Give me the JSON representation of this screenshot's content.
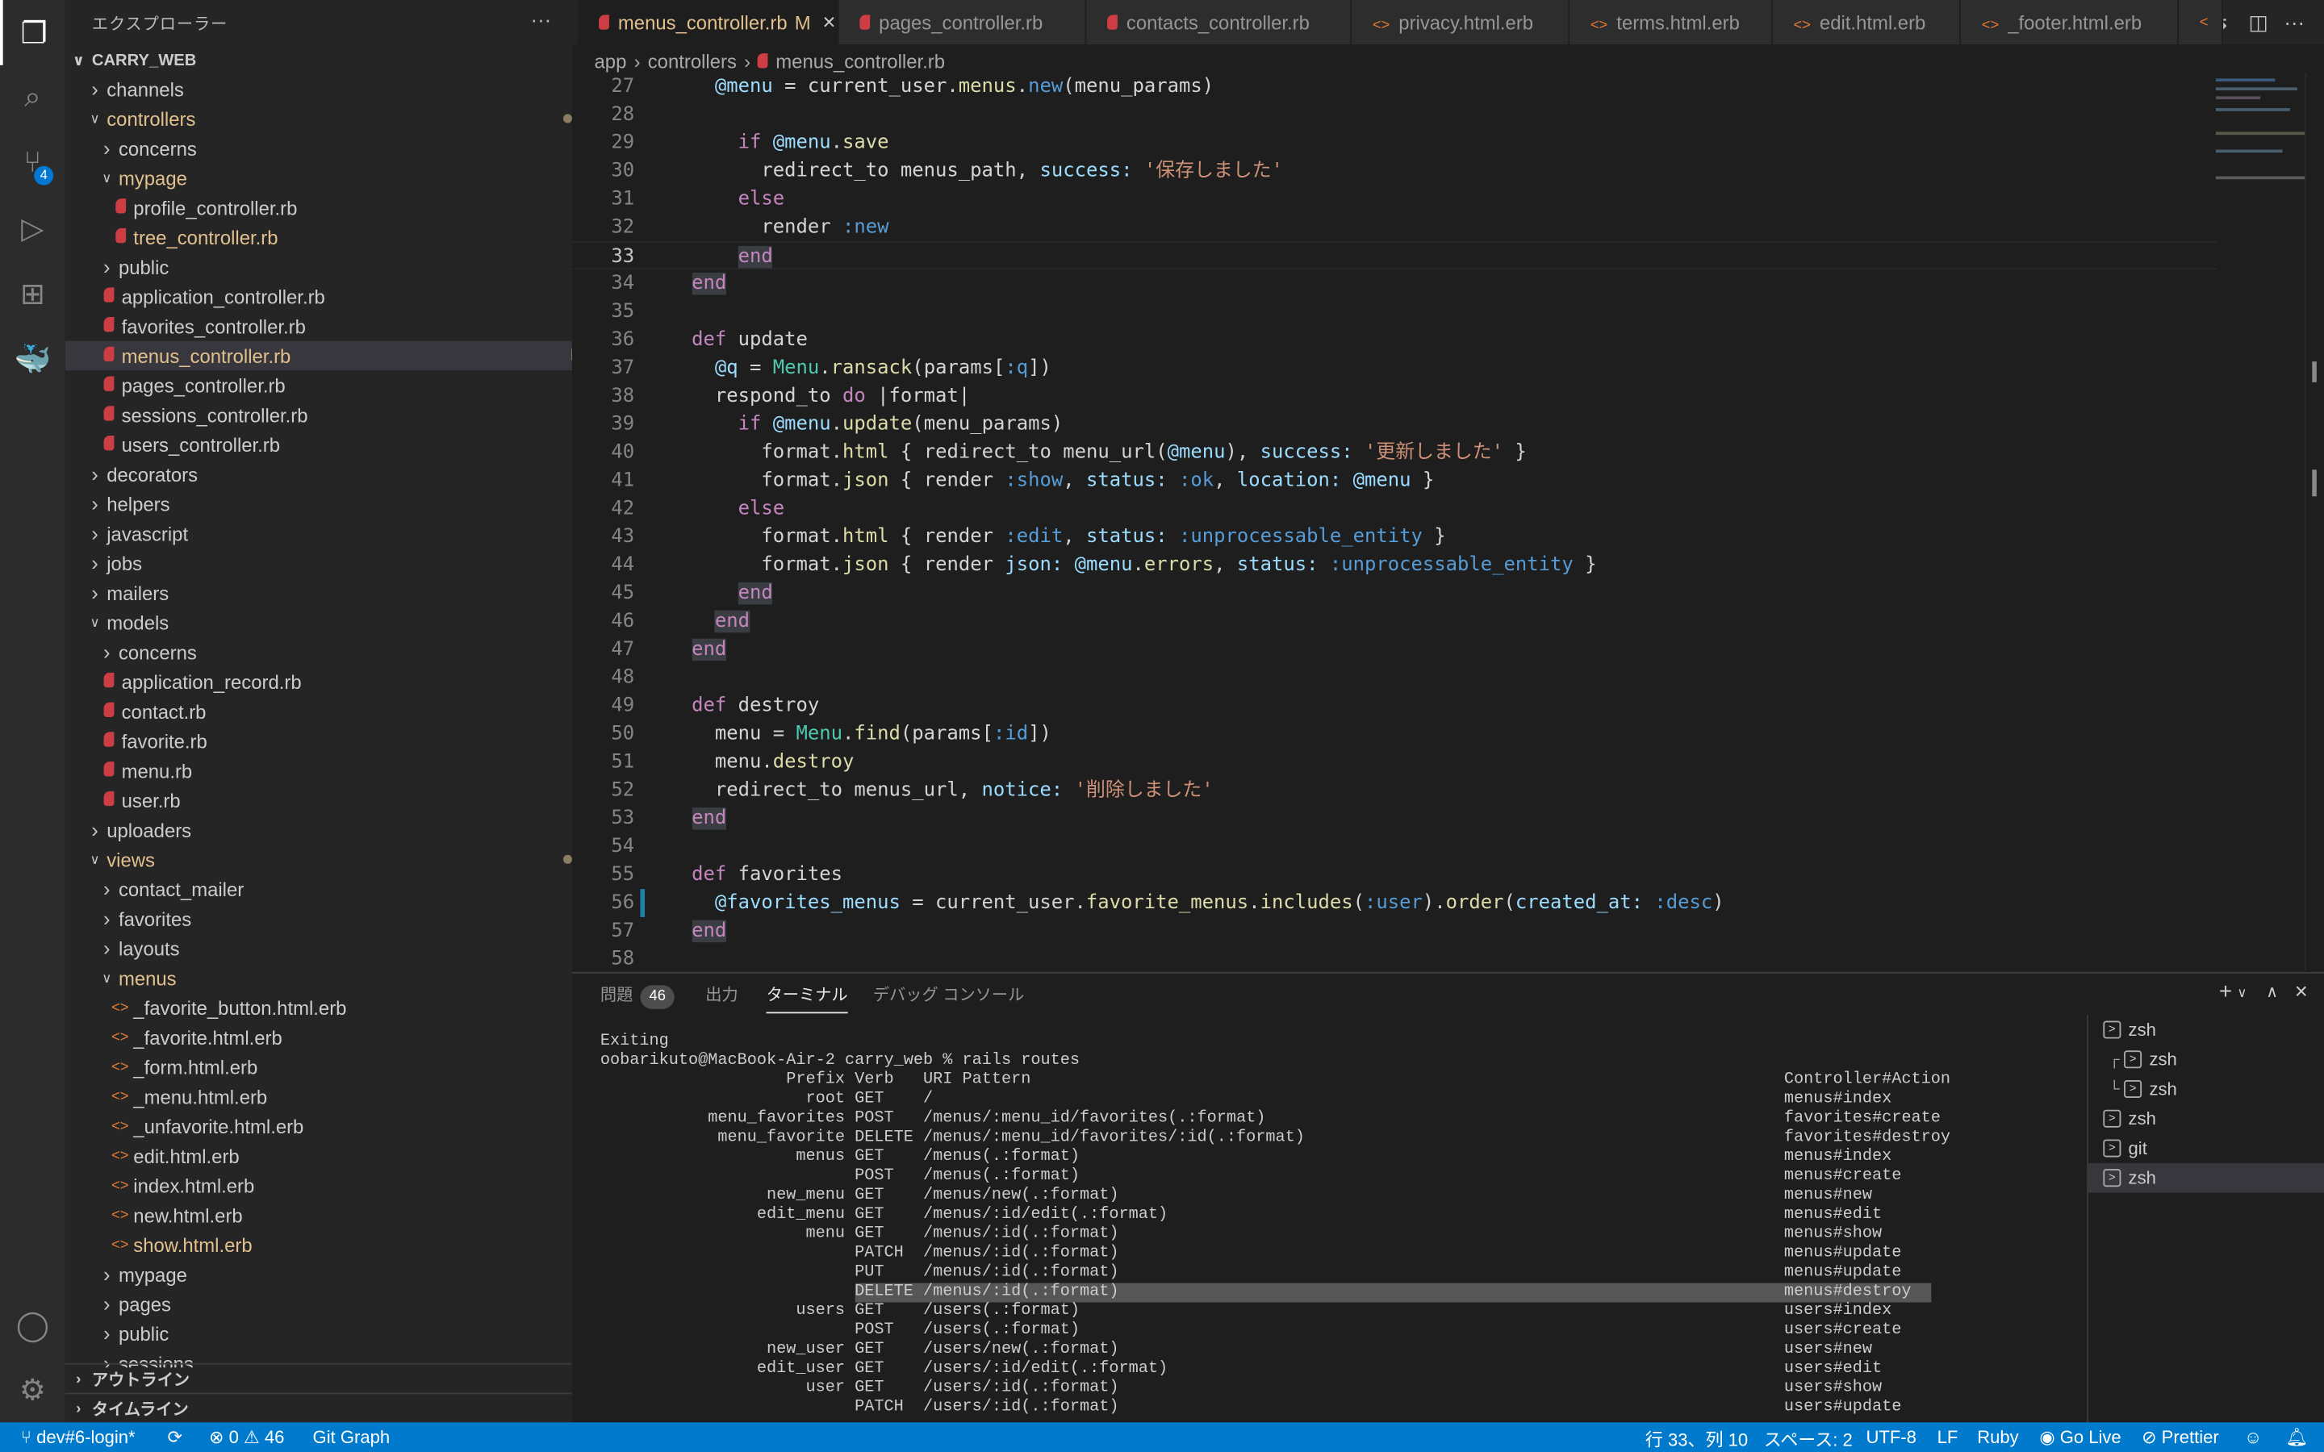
{
  "activity_bar": {
    "items": [
      {
        "name": "explorer-icon",
        "glyph": "❐",
        "active": true
      },
      {
        "name": "search-icon",
        "glyph": "⌕"
      },
      {
        "name": "source-control-icon",
        "glyph": "⑂",
        "badge": "4"
      },
      {
        "name": "run-debug-icon",
        "glyph": "▷"
      },
      {
        "name": "extensions-icon",
        "glyph": "⊞"
      },
      {
        "name": "docker-icon",
        "glyph": "🐳"
      }
    ],
    "bottom": [
      {
        "name": "account-icon",
        "glyph": "◯"
      },
      {
        "name": "gear-icon",
        "glyph": "⚙"
      }
    ]
  },
  "sidebar": {
    "title": "エクスプローラー",
    "more": "···",
    "root": "CARRY_WEB",
    "items": [
      {
        "label": "channels",
        "depth": 1,
        "kind": "folder",
        "open": false
      },
      {
        "label": "controllers",
        "depth": 1,
        "kind": "folder",
        "open": true,
        "mod": "dot"
      },
      {
        "label": "concerns",
        "depth": 2,
        "kind": "folder",
        "open": false
      },
      {
        "label": "mypage",
        "depth": 2,
        "kind": "folder",
        "open": true,
        "mod": "dot"
      },
      {
        "label": "profile_controller.rb",
        "depth": 3,
        "kind": "ruby"
      },
      {
        "label": "tree_controller.rb",
        "depth": 3,
        "kind": "ruby",
        "mod": "M"
      },
      {
        "label": "public",
        "depth": 2,
        "kind": "folder",
        "open": false
      },
      {
        "label": "application_controller.rb",
        "depth": 2,
        "kind": "ruby"
      },
      {
        "label": "favorites_controller.rb",
        "depth": 2,
        "kind": "ruby"
      },
      {
        "label": "menus_controller.rb",
        "depth": 2,
        "kind": "ruby",
        "mod": "M",
        "selected": true
      },
      {
        "label": "pages_controller.rb",
        "depth": 2,
        "kind": "ruby"
      },
      {
        "label": "sessions_controller.rb",
        "depth": 2,
        "kind": "ruby"
      },
      {
        "label": "users_controller.rb",
        "depth": 2,
        "kind": "ruby"
      },
      {
        "label": "decorators",
        "depth": 1,
        "kind": "folder",
        "open": false
      },
      {
        "label": "helpers",
        "depth": 1,
        "kind": "folder",
        "open": false
      },
      {
        "label": "javascript",
        "depth": 1,
        "kind": "folder",
        "open": false
      },
      {
        "label": "jobs",
        "depth": 1,
        "kind": "folder",
        "open": false
      },
      {
        "label": "mailers",
        "depth": 1,
        "kind": "folder",
        "open": false
      },
      {
        "label": "models",
        "depth": 1,
        "kind": "folder",
        "open": true
      },
      {
        "label": "concerns",
        "depth": 2,
        "kind": "folder",
        "open": false
      },
      {
        "label": "application_record.rb",
        "depth": 2,
        "kind": "ruby"
      },
      {
        "label": "contact.rb",
        "depth": 2,
        "kind": "ruby"
      },
      {
        "label": "favorite.rb",
        "depth": 2,
        "kind": "ruby"
      },
      {
        "label": "menu.rb",
        "depth": 2,
        "kind": "ruby"
      },
      {
        "label": "user.rb",
        "depth": 2,
        "kind": "ruby"
      },
      {
        "label": "uploaders",
        "depth": 1,
        "kind": "folder",
        "open": false
      },
      {
        "label": "views",
        "depth": 1,
        "kind": "folder",
        "open": true,
        "mod": "dot"
      },
      {
        "label": "contact_mailer",
        "depth": 2,
        "kind": "folder",
        "open": false
      },
      {
        "label": "favorites",
        "depth": 2,
        "kind": "folder",
        "open": false
      },
      {
        "label": "layouts",
        "depth": 2,
        "kind": "folder",
        "open": false
      },
      {
        "label": "menus",
        "depth": 2,
        "kind": "folder",
        "open": true,
        "mod": "dot"
      },
      {
        "label": "_favorite_button.html.erb",
        "depth": 3,
        "kind": "erb"
      },
      {
        "label": "_favorite.html.erb",
        "depth": 3,
        "kind": "erb"
      },
      {
        "label": "_form.html.erb",
        "depth": 3,
        "kind": "erb"
      },
      {
        "label": "_menu.html.erb",
        "depth": 3,
        "kind": "erb"
      },
      {
        "label": "_unfavorite.html.erb",
        "depth": 3,
        "kind": "erb"
      },
      {
        "label": "edit.html.erb",
        "depth": 3,
        "kind": "erb"
      },
      {
        "label": "index.html.erb",
        "depth": 3,
        "kind": "erb"
      },
      {
        "label": "new.html.erb",
        "depth": 3,
        "kind": "erb"
      },
      {
        "label": "show.html.erb",
        "depth": 3,
        "kind": "erb",
        "mod": "M"
      },
      {
        "label": "mypage",
        "depth": 2,
        "kind": "folder",
        "open": false
      },
      {
        "label": "pages",
        "depth": 2,
        "kind": "folder",
        "open": false
      },
      {
        "label": "public",
        "depth": 2,
        "kind": "folder",
        "open": false
      },
      {
        "label": "sessions",
        "depth": 2,
        "kind": "folder",
        "open": false
      }
    ],
    "outline": "アウトライン",
    "timeline": "タイムライン"
  },
  "tabs": [
    {
      "label": "menus_controller.rb",
      "kind": "ruby",
      "active": true,
      "mod": "M"
    },
    {
      "label": "pages_controller.rb",
      "kind": "ruby"
    },
    {
      "label": "contacts_controller.rb",
      "kind": "ruby"
    },
    {
      "label": "privacy.html.erb",
      "kind": "erb"
    },
    {
      "label": "terms.html.erb",
      "kind": "erb"
    },
    {
      "label": "edit.html.erb",
      "kind": "erb"
    },
    {
      "label": "_footer.html.erb",
      "kind": "erb"
    }
  ],
  "breadcrumb": [
    "app",
    "controllers",
    "menus_controller.rb"
  ],
  "editor": {
    "current_line": 33,
    "modified_lines": [
      56
    ],
    "lines": [
      {
        "n": 27,
        "t": "    @menu = current_user.menus.new(menu_params)"
      },
      {
        "n": 28,
        "t": ""
      },
      {
        "n": 29,
        "t": "      if @menu.save"
      },
      {
        "n": 30,
        "t": "        redirect_to menus_path, success: '保存しました'"
      },
      {
        "n": 31,
        "t": "      else"
      },
      {
        "n": 32,
        "t": "        render :new"
      },
      {
        "n": 33,
        "t": "      end"
      },
      {
        "n": 34,
        "t": "  end"
      },
      {
        "n": 35,
        "t": ""
      },
      {
        "n": 36,
        "t": "  def update"
      },
      {
        "n": 37,
        "t": "    @q = Menu.ransack(params[:q])"
      },
      {
        "n": 38,
        "t": "    respond_to do |format|"
      },
      {
        "n": 39,
        "t": "      if @menu.update(menu_params)"
      },
      {
        "n": 40,
        "t": "        format.html { redirect_to menu_url(@menu), success: '更新しました' }"
      },
      {
        "n": 41,
        "t": "        format.json { render :show, status: :ok, location: @menu }"
      },
      {
        "n": 42,
        "t": "      else"
      },
      {
        "n": 43,
        "t": "        format.html { render :edit, status: :unprocessable_entity }"
      },
      {
        "n": 44,
        "t": "        format.json { render json: @menu.errors, status: :unprocessable_entity }"
      },
      {
        "n": 45,
        "t": "      end"
      },
      {
        "n": 46,
        "t": "    end"
      },
      {
        "n": 47,
        "t": "  end"
      },
      {
        "n": 48,
        "t": ""
      },
      {
        "n": 49,
        "t": "  def destroy"
      },
      {
        "n": 50,
        "t": "    menu = Menu.find(params[:id])"
      },
      {
        "n": 51,
        "t": "    menu.destroy"
      },
      {
        "n": 52,
        "t": "    redirect_to menus_url, notice: '削除しました'"
      },
      {
        "n": 53,
        "t": "  end"
      },
      {
        "n": 54,
        "t": ""
      },
      {
        "n": 55,
        "t": "  def favorites"
      },
      {
        "n": 56,
        "t": "    @favorites_menus = current_user.favorite_menus.includes(:user).order(created_at: :desc)"
      },
      {
        "n": 57,
        "t": "  end"
      },
      {
        "n": 58,
        "t": ""
      }
    ]
  },
  "panel": {
    "tabs": [
      {
        "label": "問題",
        "badge": "46"
      },
      {
        "label": "出力"
      },
      {
        "label": "ターミナル",
        "active": true
      },
      {
        "label": "デバッグ コンソール"
      }
    ],
    "actions": {
      "new": "+",
      "dropdown": "∨",
      "maximize": "∧",
      "close": "×"
    },
    "terminal": {
      "pre": [
        "Exiting",
        "oobarikuto@MacBook-Air-2 carry_web % rails routes"
      ],
      "header": {
        "prefix": "Prefix",
        "verb": "Verb",
        "uri": "URI Pattern",
        "action": "Controller#Action"
      },
      "routes": [
        {
          "prefix": "root",
          "verb": "GET",
          "uri": "/",
          "action": "menus#index"
        },
        {
          "prefix": "menu_favorites",
          "verb": "POST",
          "uri": "/menus/:menu_id/favorites(.:format)",
          "action": "favorites#create"
        },
        {
          "prefix": "menu_favorite",
          "verb": "DELETE",
          "uri": "/menus/:menu_id/favorites/:id(.:format)",
          "action": "favorites#destroy"
        },
        {
          "prefix": "menus",
          "verb": "GET",
          "uri": "/menus(.:format)",
          "action": "menus#index"
        },
        {
          "prefix": "",
          "verb": "POST",
          "uri": "/menus(.:format)",
          "action": "menus#create"
        },
        {
          "prefix": "new_menu",
          "verb": "GET",
          "uri": "/menus/new(.:format)",
          "action": "menus#new"
        },
        {
          "prefix": "edit_menu",
          "verb": "GET",
          "uri": "/menus/:id/edit(.:format)",
          "action": "menus#edit"
        },
        {
          "prefix": "menu",
          "verb": "GET",
          "uri": "/menus/:id(.:format)",
          "action": "menus#show"
        },
        {
          "prefix": "",
          "verb": "PATCH",
          "uri": "/menus/:id(.:format)",
          "action": "menus#update"
        },
        {
          "prefix": "",
          "verb": "PUT",
          "uri": "/menus/:id(.:format)",
          "action": "menus#update"
        },
        {
          "prefix": "",
          "verb": "DELETE",
          "uri": "/menus/:id(.:format)",
          "action": "menus#destroy",
          "selected": true
        },
        {
          "prefix": "users",
          "verb": "GET",
          "uri": "/users(.:format)",
          "action": "users#index"
        },
        {
          "prefix": "",
          "verb": "POST",
          "uri": "/users(.:format)",
          "action": "users#create"
        },
        {
          "prefix": "new_user",
          "verb": "GET",
          "uri": "/users/new(.:format)",
          "action": "users#new"
        },
        {
          "prefix": "edit_user",
          "verb": "GET",
          "uri": "/users/:id/edit(.:format)",
          "action": "users#edit"
        },
        {
          "prefix": "user",
          "verb": "GET",
          "uri": "/users/:id(.:format)",
          "action": "users#show"
        },
        {
          "prefix": "",
          "verb": "PATCH",
          "uri": "/users/:id(.:format)",
          "action": "users#update"
        }
      ]
    },
    "terminal_list": [
      {
        "label": "zsh"
      },
      {
        "label": "zsh",
        "split": "top"
      },
      {
        "label": "zsh",
        "split": "bottom"
      },
      {
        "label": "zsh"
      },
      {
        "label": "git"
      },
      {
        "label": "zsh",
        "selected": true
      }
    ]
  },
  "status_bar": {
    "color": "#007acc",
    "branch": "dev#6-login*",
    "errors": "0",
    "warnings": "46",
    "git_graph": "Git Graph",
    "position": "行 33、列 10",
    "spaces": "スペース: 2",
    "encoding": "UTF-8",
    "eol": "LF",
    "language": "Ruby",
    "go_live": "Go Live",
    "prettier": "Prettier"
  }
}
